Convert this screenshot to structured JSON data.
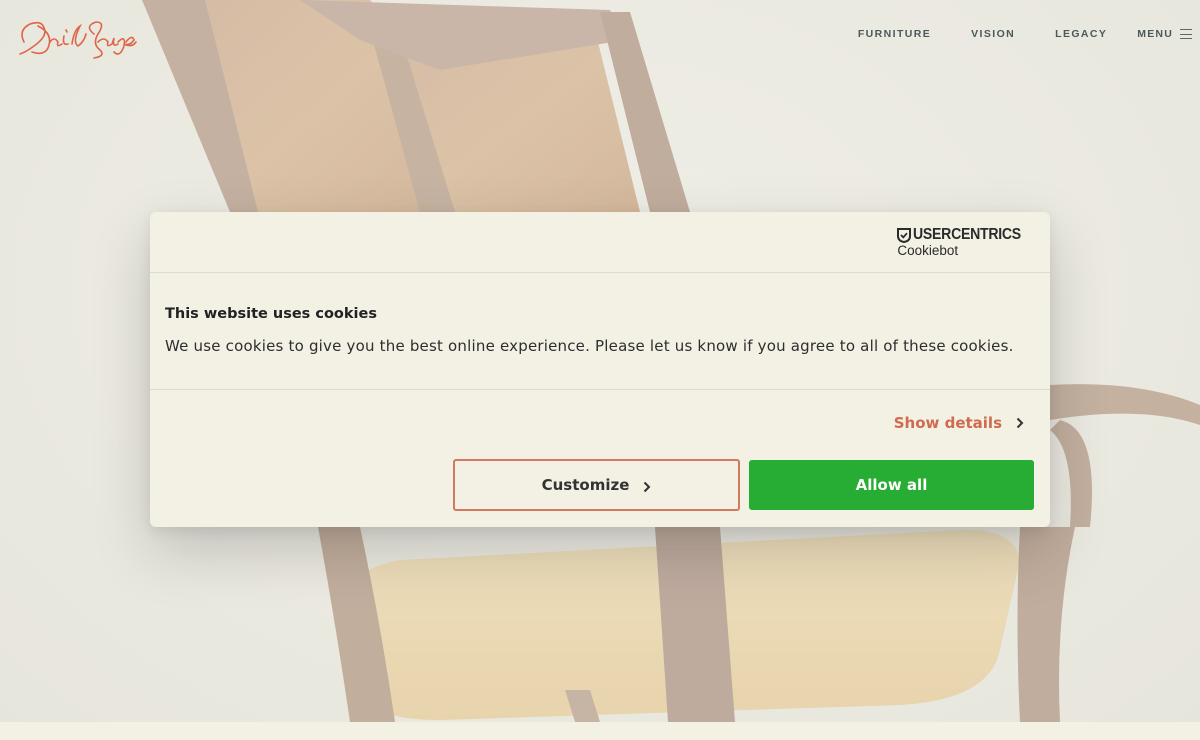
{
  "header": {
    "logo_alt": "David Savage",
    "nav": [
      "FURNITURE",
      "VISION",
      "LEGACY"
    ],
    "menu_label": "MENU"
  },
  "hero": {
    "image": "chair-icon"
  },
  "cookie_dialog": {
    "brand_name": "USERCENTRICS",
    "brand_sub": "Cookiebot",
    "title": "This website uses cookies",
    "text": "We use cookies to give you the best online experience. Please let us know if you agree to all of these cookies.",
    "show_details": "Show details",
    "customize": "Customize",
    "allow_all": "Allow all"
  },
  "colors": {
    "accent": "#d06a50",
    "allow_green": "#27ad34",
    "nav_text": "#4a5a5c",
    "dialog_bg": "#f3f0e4"
  }
}
